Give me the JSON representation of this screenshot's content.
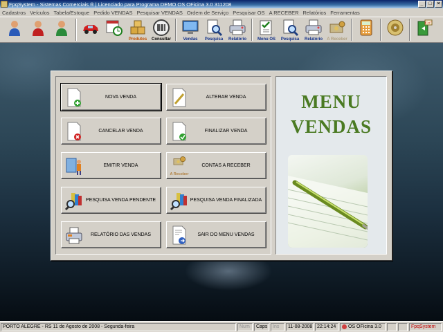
{
  "window": {
    "title": "FpqSystem - Sistemas Comerciais ®  | Licenciado para  Programa DEMO OS OFicina 3.0 311208",
    "controls": [
      "_",
      "□",
      "×"
    ]
  },
  "menubar": [
    "Cadastros",
    "Veículos",
    "Tabela/Estoque",
    "Pedido VENDAS",
    "Pesquisar VENDAS",
    "Ordem de Serviço",
    "Pesquisar OS",
    "A RECEBER",
    "Relatórios",
    "Ferramentas"
  ],
  "toolbar": {
    "produtos": "Produtos",
    "consultar": "Consultar",
    "vendas": "Vendas",
    "pesquisa1": "Pesquisa",
    "relatorio1": "Relatório",
    "menu_os": "Menu OS",
    "pesquisa2": "Pesquisa",
    "relatorio2": "Relatório",
    "a_receber": "A Receber",
    "exit_badge": "EXIT"
  },
  "menu": {
    "title_line1": "MENU",
    "title_line2": "VENDAS",
    "buttons": {
      "nova_venda": "NOVA VENDA",
      "alterar_venda": "ALTERAR VENDA",
      "cancelar_venda": "CANCELAR VENDA",
      "finalizar_venda": "FINALIZAR VENDA",
      "emitir_venda": "EMITIR VENDA",
      "contas_a_receber": "CONTAS  A  RECEBER",
      "pesquisa_pendente": "PESQUISA VENDA PENDENTE",
      "pesquisa_finalizada": "PESQUISA VENDA FINALIZADA",
      "relatorio_vendas": "RELATÓRIO DAS VENDAS",
      "sair": "SAIR DO MENU VENDAS"
    },
    "a_receber_icon_caption": "A Receber"
  },
  "statusbar": {
    "location_date": "PORTO ALEGRE - RS 11 de Agosto de 2008 - Segunda-feira",
    "num": "Num",
    "caps": "Caps",
    "ins": "Ins",
    "date": "11-08-2008",
    "time": "22:14:24",
    "product": "OS OFicina 3.0",
    "brand": "FpqSystem"
  }
}
